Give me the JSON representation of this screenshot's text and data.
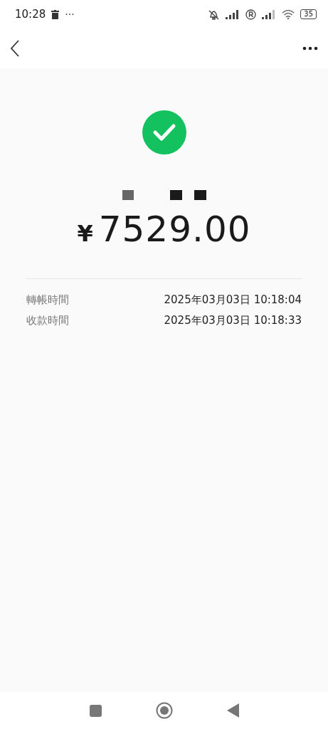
{
  "status_bar": {
    "time": "10:28",
    "dots": "···",
    "battery": "35"
  },
  "receipt": {
    "currency": "¥",
    "amount": "7529.00",
    "details": [
      {
        "label": "轉帳時間",
        "value": "2025年03月03日 10:18:04"
      },
      {
        "label": "收款時間",
        "value": "2025年03月03日 10:18:33"
      }
    ]
  }
}
